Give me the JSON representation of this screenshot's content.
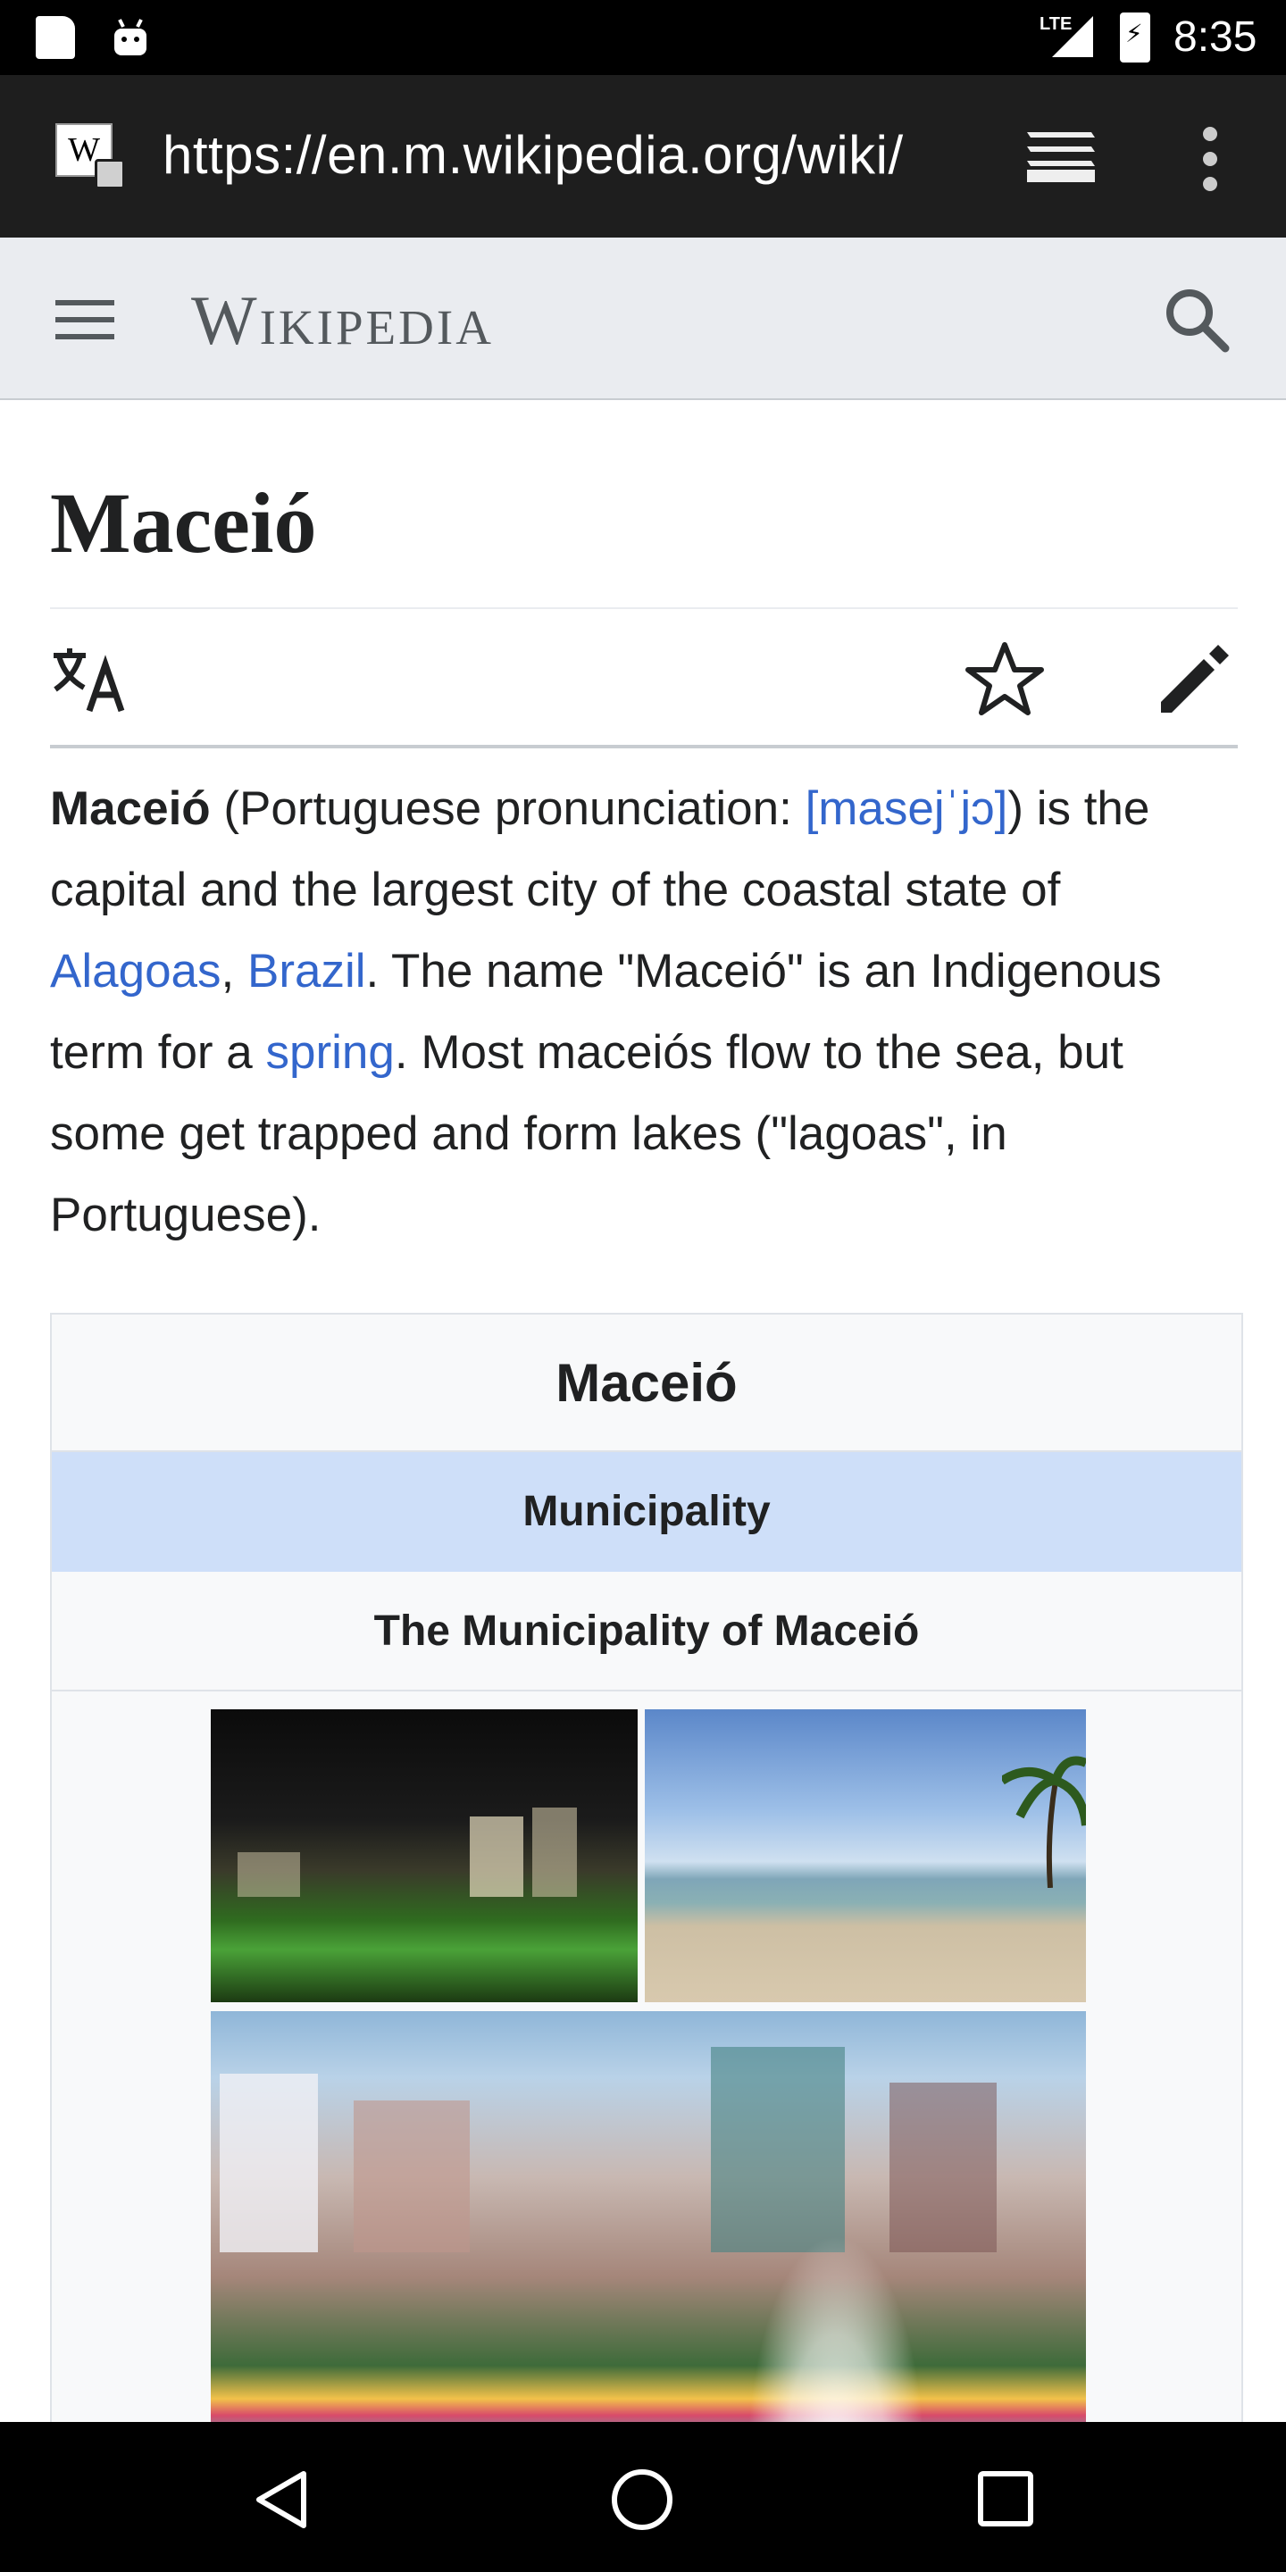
{
  "status_bar": {
    "network": "LTE",
    "time": "8:35",
    "icons": [
      "sd-card-icon",
      "android-icon",
      "signal-icon",
      "battery-charging-icon"
    ]
  },
  "browser": {
    "url": "https://en.m.wikipedia.org/wiki/",
    "site_icon_letter": "W",
    "icons": [
      "site-lock-icon",
      "tabs-icon",
      "overflow-menu-icon"
    ]
  },
  "wiki_header": {
    "wordmark": "Wikipedia",
    "icons": [
      "hamburger-menu-icon",
      "search-icon"
    ]
  },
  "article": {
    "title": "Maceió",
    "actions": [
      "language-icon",
      "star-icon",
      "edit-pencil-icon"
    ],
    "lead": {
      "bold_name": "Maceió",
      "t1": " (Portuguese pronunciation: ",
      "ipa": "[masejˈjɔ]",
      "t2": ") is the capital and the largest city of the coastal state of ",
      "link_alagoas": "Alagoas",
      "t3": ", ",
      "link_brazil": "Brazil",
      "t4": ". The name \"Maceió\" is an Indigenous term for a ",
      "link_spring": "spring",
      "t5": ". Most maceiós flow to the sea, but some get trapped and form lakes (\"lagoas\", in Portuguese)."
    },
    "infobox": {
      "title": "Maceió",
      "type": "Municipality",
      "subtitle": "The Municipality of Maceió",
      "images": [
        "city-at-night-photo",
        "beach-photo",
        "beachfront-flyboard-photo"
      ]
    }
  },
  "nav_bar": {
    "icons": [
      "back-icon",
      "home-icon",
      "recents-icon"
    ]
  },
  "colors": {
    "link": "#3366cc",
    "header_bg": "#eaecf0",
    "infobox_type_bg": "#cedff9",
    "text": "#202122"
  }
}
